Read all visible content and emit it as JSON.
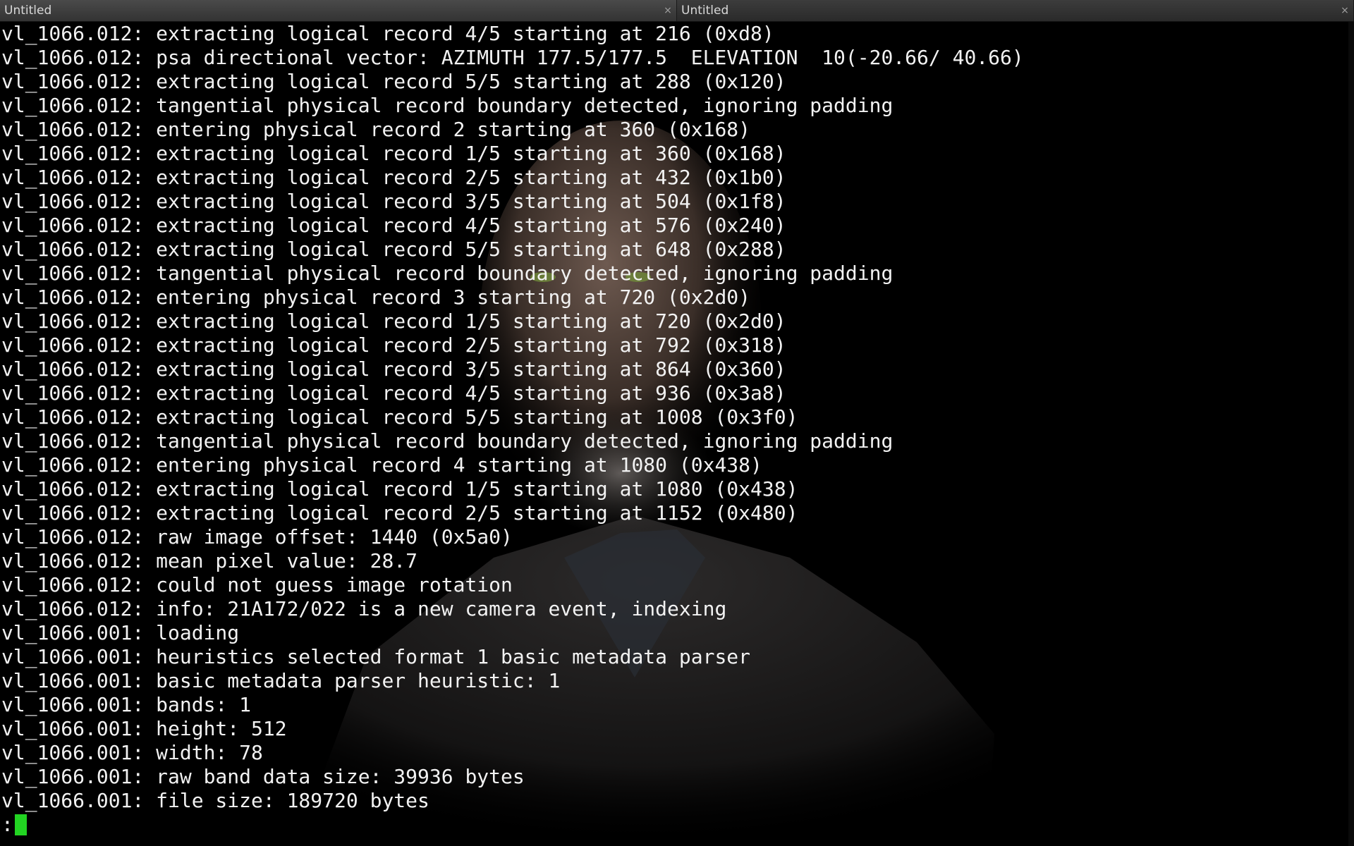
{
  "tabs": [
    {
      "title": "Untitled",
      "close": "×"
    },
    {
      "title": "Untitled",
      "close": "×"
    }
  ],
  "terminal": {
    "lines": [
      "vl_1066.012: extracting logical record 4/5 starting at 216 (0xd8)",
      "vl_1066.012: psa directional vector: AZIMUTH 177.5/177.5  ELEVATION  10(-20.66/ 40.66)",
      "vl_1066.012: extracting logical record 5/5 starting at 288 (0x120)",
      "vl_1066.012: tangential physical record boundary detected, ignoring padding",
      "vl_1066.012: entering physical record 2 starting at 360 (0x168)",
      "vl_1066.012: extracting logical record 1/5 starting at 360 (0x168)",
      "vl_1066.012: extracting logical record 2/5 starting at 432 (0x1b0)",
      "vl_1066.012: extracting logical record 3/5 starting at 504 (0x1f8)",
      "vl_1066.012: extracting logical record 4/5 starting at 576 (0x240)",
      "vl_1066.012: extracting logical record 5/5 starting at 648 (0x288)",
      "vl_1066.012: tangential physical record boundary detected, ignoring padding",
      "vl_1066.012: entering physical record 3 starting at 720 (0x2d0)",
      "vl_1066.012: extracting logical record 1/5 starting at 720 (0x2d0)",
      "vl_1066.012: extracting logical record 2/5 starting at 792 (0x318)",
      "vl_1066.012: extracting logical record 3/5 starting at 864 (0x360)",
      "vl_1066.012: extracting logical record 4/5 starting at 936 (0x3a8)",
      "vl_1066.012: extracting logical record 5/5 starting at 1008 (0x3f0)",
      "vl_1066.012: tangential physical record boundary detected, ignoring padding",
      "vl_1066.012: entering physical record 4 starting at 1080 (0x438)",
      "vl_1066.012: extracting logical record 1/5 starting at 1080 (0x438)",
      "vl_1066.012: extracting logical record 2/5 starting at 1152 (0x480)",
      "vl_1066.012: raw image offset: 1440 (0x5a0)",
      "vl_1066.012: mean pixel value: 28.7",
      "vl_1066.012: could not guess image rotation",
      "vl_1066.012: info: 21A172/022 is a new camera event, indexing",
      "vl_1066.001: loading",
      "vl_1066.001: heuristics selected format 1 basic metadata parser",
      "vl_1066.001: basic metadata parser heuristic: 1",
      "vl_1066.001: bands: 1",
      "vl_1066.001: height: 512",
      "vl_1066.001: width: 78",
      "vl_1066.001: raw band data size: 39936 bytes",
      "vl_1066.001: file size: 189720 bytes"
    ],
    "prompt": ":",
    "cursor_color": "#22d422",
    "text_color": "#f2f2f2",
    "background_color": "#000000"
  }
}
